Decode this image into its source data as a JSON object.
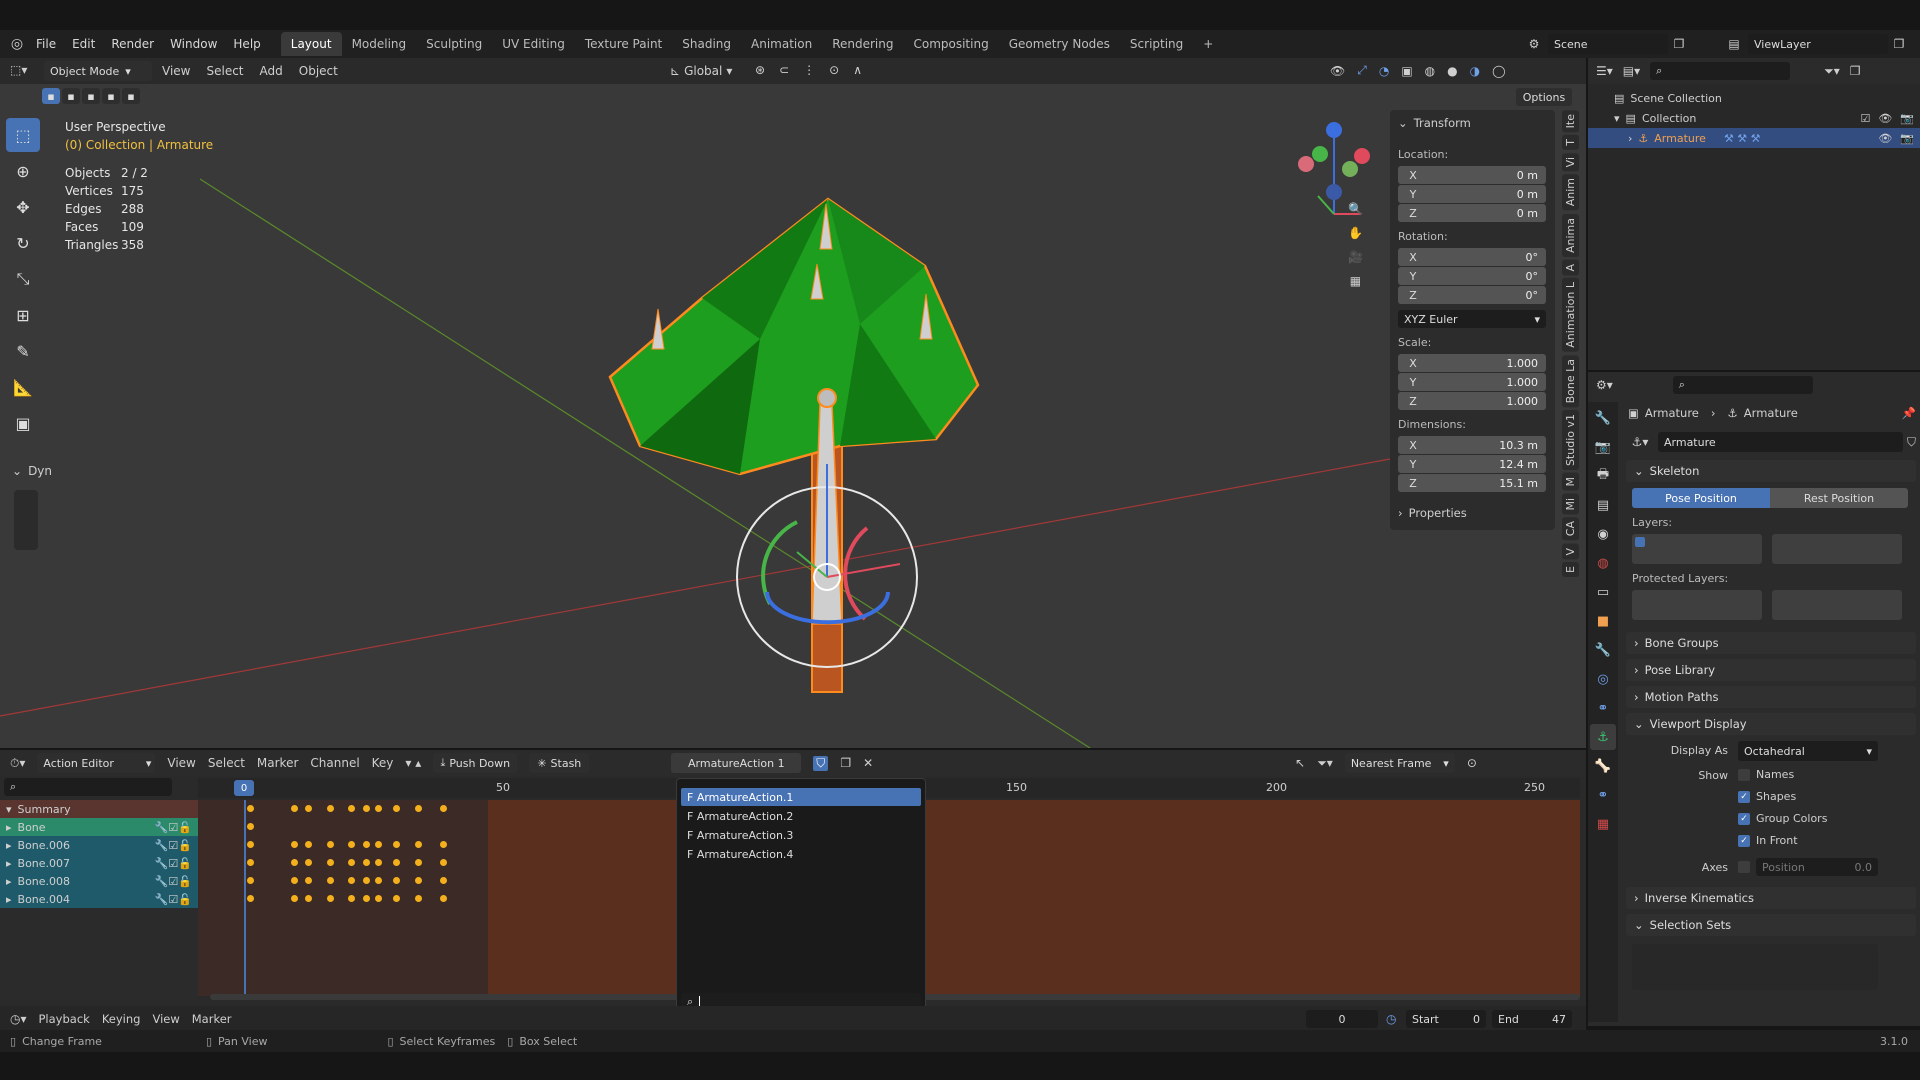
{
  "topbar": {
    "menus": [
      "File",
      "Edit",
      "Render",
      "Window",
      "Help"
    ],
    "workspaces": [
      "Layout",
      "Modeling",
      "Sculpting",
      "UV Editing",
      "Texture Paint",
      "Shading",
      "Animation",
      "Rendering",
      "Compositing",
      "Geometry Nodes",
      "Scripting",
      "+"
    ],
    "active_workspace": "Layout",
    "scene": "Scene",
    "view_layer": "ViewLayer"
  },
  "viewport": {
    "mode": "Object Mode",
    "menus": [
      "View",
      "Select",
      "Add",
      "Object"
    ],
    "transform_orientation": "Global",
    "options_label": "Options",
    "title": "User Perspective",
    "subtitle": "(0) Collection | Armature",
    "stats": [
      {
        "k": "Objects",
        "v": "2 / 2"
      },
      {
        "k": "Vertices",
        "v": "175"
      },
      {
        "k": "Edges",
        "v": "288"
      },
      {
        "k": "Faces",
        "v": "109"
      },
      {
        "k": "Triangles",
        "v": "358"
      }
    ],
    "dyn_label": "Dyn"
  },
  "npanel": {
    "transform_title": "Transform",
    "location_label": "Location:",
    "location": [
      {
        "a": "X",
        "v": "0 m"
      },
      {
        "a": "Y",
        "v": "0 m"
      },
      {
        "a": "Z",
        "v": "0 m"
      }
    ],
    "rotation_label": "Rotation:",
    "rotation": [
      {
        "a": "X",
        "v": "0°"
      },
      {
        "a": "Y",
        "v": "0°"
      },
      {
        "a": "Z",
        "v": "0°"
      }
    ],
    "rotation_mode": "XYZ Euler",
    "scale_label": "Scale:",
    "scale": [
      {
        "a": "X",
        "v": "1.000"
      },
      {
        "a": "Y",
        "v": "1.000"
      },
      {
        "a": "Z",
        "v": "1.000"
      }
    ],
    "dimensions_label": "Dimensions:",
    "dimensions": [
      {
        "a": "X",
        "v": "10.3 m"
      },
      {
        "a": "Y",
        "v": "12.4 m"
      },
      {
        "a": "Z",
        "v": "15.1 m"
      }
    ],
    "properties_label": "Properties",
    "side_tabs": [
      "Ite",
      "T",
      "Vi",
      "Anim",
      "Anima",
      "A",
      "Animation L",
      "Bone La",
      "Studio v1",
      "M",
      "Mi",
      "CA",
      "V",
      "E"
    ]
  },
  "outliner": {
    "scene_collection": "Scene Collection",
    "collection": "Collection",
    "armature": "Armature"
  },
  "props": {
    "breadcrumb_1": "Armature",
    "breadcrumb_2": "Armature",
    "data_name": "Armature",
    "skeleton": "Skeleton",
    "pose_position": "Pose Position",
    "rest_position": "Rest Position",
    "layers": "Layers:",
    "protected_layers": "Protected Layers:",
    "bone_groups": "Bone Groups",
    "pose_library": "Pose Library",
    "motion_paths": "Motion Paths",
    "viewport_display": "Viewport Display",
    "display_as_label": "Display As",
    "display_as_value": "Octahedral",
    "show_label": "Show",
    "names": "Names",
    "shapes": "Shapes",
    "group_colors": "Group Colors",
    "in_front": "In Front",
    "axes": "Axes",
    "position": "Position",
    "position_value": "0.0",
    "inverse_kinematics": "Inverse Kinematics",
    "selection_sets": "Selection Sets"
  },
  "timeline": {
    "editor": "Action Editor",
    "menus": [
      "View",
      "Select",
      "Marker",
      "Channel",
      "Key"
    ],
    "push_down": "Push Down",
    "stash": "Stash",
    "action": "ArmatureAction 1",
    "snap": "Nearest Frame",
    "current_frame_marker": "0",
    "ruler": [
      "50",
      "150",
      "200",
      "250"
    ],
    "channels": [
      {
        "name": "Summary"
      },
      {
        "name": "Bone"
      },
      {
        "name": "Bone.006"
      },
      {
        "name": "Bone.007"
      },
      {
        "name": "Bone.008"
      },
      {
        "name": "Bone.004"
      }
    ],
    "popup_items": [
      "F ArmatureAction.1",
      "F ArmatureAction.2",
      "F ArmatureAction.3",
      "F ArmatureAction.4"
    ]
  },
  "playback": {
    "menus": [
      "Playback",
      "Keying",
      "View",
      "Marker"
    ],
    "frame": "0",
    "start_label": "Start",
    "start": "0",
    "end_label": "End",
    "end": "47"
  },
  "status": {
    "change_frame": "Change Frame",
    "pan_view": "Pan View",
    "select_keyframes": "Select Keyframes",
    "box_select": "Box Select",
    "version": "3.1.0"
  },
  "colors": {
    "accent": "#4772b3",
    "selected": "#f4b01c",
    "tree_green": "#1e9e1e",
    "trunk": "#c85a1e"
  }
}
